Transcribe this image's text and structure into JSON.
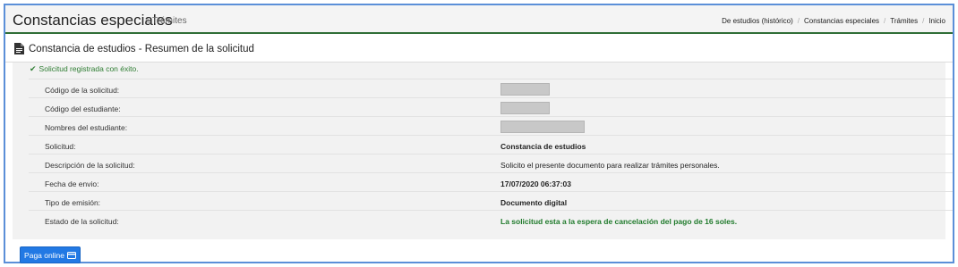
{
  "header": {
    "title": "Constancias especiales",
    "subtitle": "Trámites",
    "home_icon": "home-icon",
    "border_color": "#2f6e36",
    "breadcrumb": [
      {
        "label": "De estudios (histórico)"
      },
      {
        "label": "Constancias especiales"
      },
      {
        "label": "Trámites"
      },
      {
        "label": "Inicio"
      }
    ]
  },
  "panel": {
    "title": "Constancia de estudios - Resumen de la solicitud",
    "icon": "document-icon"
  },
  "success_message": "Solicitud registrada con éxito.",
  "success_icon": "check-icon",
  "details": [
    {
      "label": "Código de la solicitud:",
      "value": ""
    },
    {
      "label": "Código del estudiante:",
      "value": ""
    },
    {
      "label": "Nombres del estudiante:",
      "value": ""
    },
    {
      "label": "Solicitud:",
      "value": "Constancia de estudios"
    },
    {
      "label": "Descripción de la solicitud:",
      "value": "Solicito el presente documento para realizar trámites personales."
    },
    {
      "label": "Fecha de envio:",
      "value": "17/07/2020 06:37:03"
    },
    {
      "label": "Tipo de emisión:",
      "value": "Documento digital"
    },
    {
      "label": "Estado de la solicitud:",
      "value": "La solicitud esta a la espera de cancelación del pago de 16 soles."
    }
  ],
  "pay_button": {
    "label": "Paga online",
    "icon": "credit-card-icon",
    "color": "#2279e4"
  },
  "colors": {
    "frame_border": "#5b8fd8",
    "success_text": "#2e7d32",
    "status_text": "#1f7a2b"
  }
}
